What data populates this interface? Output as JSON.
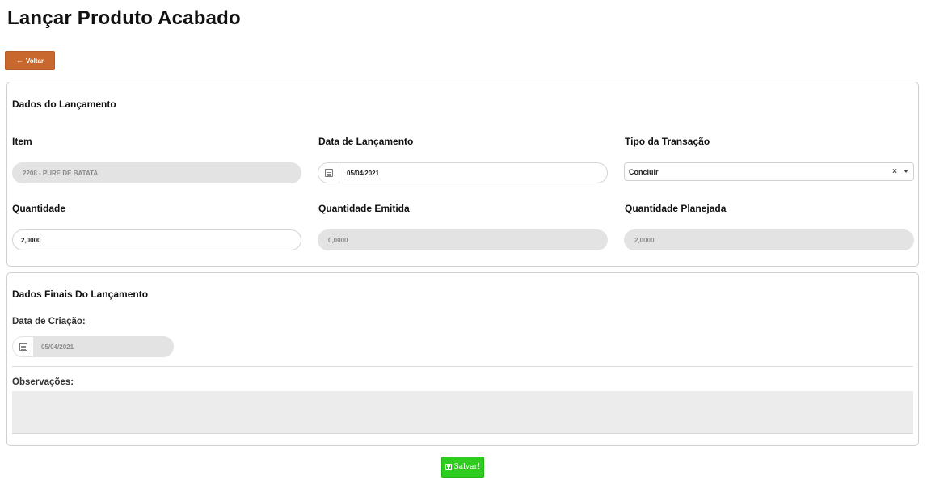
{
  "page": {
    "title": "Lançar Produto Acabado"
  },
  "actions": {
    "back_label": "Voltar",
    "save_label": "Salvar!"
  },
  "launch_section": {
    "title": "Dados do Lançamento",
    "item": {
      "label": "Item",
      "value": "2208 - PURE DE BATATA"
    },
    "launch_date": {
      "label": "Data de Lançamento",
      "value": "05/04/2021"
    },
    "transaction_type": {
      "label": "Tipo da Transação",
      "value": "Concluir",
      "clear_icon": "×"
    },
    "quantity": {
      "label": "Quantidade",
      "value": "2,0000"
    },
    "issued_quantity": {
      "label": "Quantidade Emitida",
      "value": "0,0000"
    },
    "planned_quantity": {
      "label": "Quantidade Planejada",
      "value": "2,0000"
    }
  },
  "final_section": {
    "title": "Dados Finais Do Lançamento",
    "creation_date": {
      "label": "Data de Criação:",
      "value": "05/04/2021"
    },
    "notes": {
      "label": "Observações:",
      "value": ""
    }
  },
  "colors": {
    "back_button": "#c8682f",
    "save_button": "#2ecc1f",
    "readonly_field": "#e3e3e3"
  },
  "icons": {
    "back": "arrow-left-icon",
    "calendar": "calendar-icon",
    "save": "floppy-disk-icon",
    "select_caret": "caret-down-icon",
    "select_clear": "close-icon"
  }
}
